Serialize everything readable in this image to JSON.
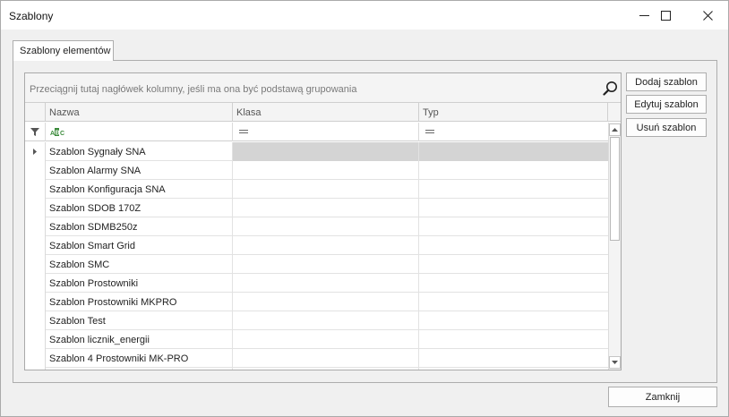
{
  "window": {
    "title": "Szablony",
    "controls": [
      "minimize-icon",
      "maximize-icon",
      "close-icon"
    ]
  },
  "tabs": [
    {
      "label": "Szablony elementów",
      "active": true
    }
  ],
  "grid": {
    "group_panel_hint": "Przeciągnij tutaj nagłówek kolumny, jeśli ma ona być podstawą grupowania",
    "columns": [
      "Nazwa",
      "Klasa",
      "Typ"
    ],
    "filter_icons": [
      "filter-funnel-icon",
      "abc-contains-icon",
      "equals-icon",
      "equals-icon"
    ],
    "rows": [
      {
        "name": "Szablon Sygnały SNA",
        "klasa": "",
        "typ": "",
        "selected": true
      },
      {
        "name": "Szablon Alarmy SNA",
        "klasa": "",
        "typ": ""
      },
      {
        "name": "Szablon Konfiguracja SNA",
        "klasa": "",
        "typ": ""
      },
      {
        "name": "Szablon SDOB 170Z",
        "klasa": "",
        "typ": ""
      },
      {
        "name": "Szablon SDMB250z",
        "klasa": "",
        "typ": ""
      },
      {
        "name": "Szablon Smart Grid",
        "klasa": "",
        "typ": ""
      },
      {
        "name": "Szablon SMC",
        "klasa": "",
        "typ": ""
      },
      {
        "name": "Szablon Prostowniki",
        "klasa": "",
        "typ": ""
      },
      {
        "name": "Szablon Prostowniki MKPRO",
        "klasa": "",
        "typ": ""
      },
      {
        "name": "Szablon Test",
        "klasa": "",
        "typ": ""
      },
      {
        "name": "Szablon licznik_energii",
        "klasa": "",
        "typ": ""
      },
      {
        "name": "Szablon 4 Prostowniki MK-PRO",
        "klasa": "",
        "typ": ""
      }
    ]
  },
  "side_buttons": {
    "add": "Dodaj szablon",
    "edit": "Edytuj szablon",
    "remove": "Usuń szablon"
  },
  "footer": {
    "close": "Zamknij"
  },
  "colors": {
    "selected_row": "#d4d4d4",
    "border": "#adadad",
    "background": "#f0f0f0"
  }
}
